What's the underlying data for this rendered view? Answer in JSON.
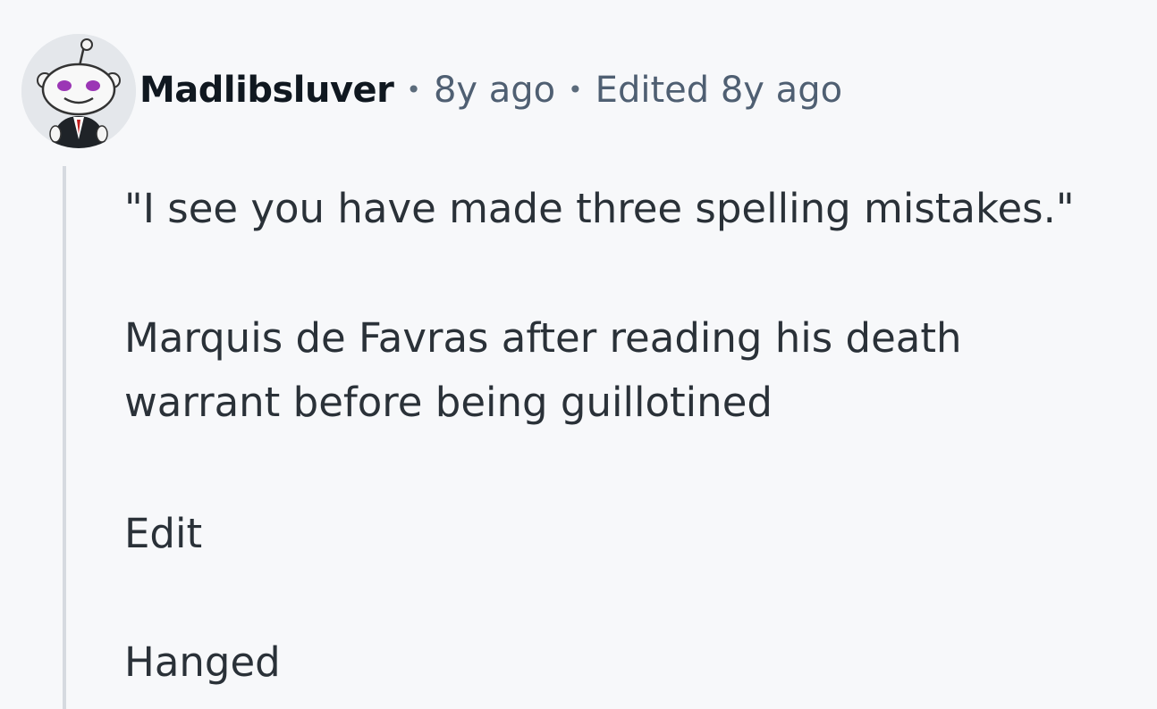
{
  "comment": {
    "author": {
      "username": "Madlibsluver",
      "avatar_icon": "snoo-avatar-icon"
    },
    "separator": "•",
    "timestamp": "8y ago",
    "edited": "Edited 8y ago",
    "paragraphs": [
      "\"I see you have made three spelling mistakes.\"",
      "Marquis de Favras after reading his death warrant before being guillotined",
      "Edit",
      "Hanged"
    ]
  },
  "colors": {
    "background": "#f7f8fa",
    "thread_line": "#d6dae0",
    "username": "#101820",
    "meta_text": "#4f5f72",
    "body_text": "#2a3138"
  }
}
